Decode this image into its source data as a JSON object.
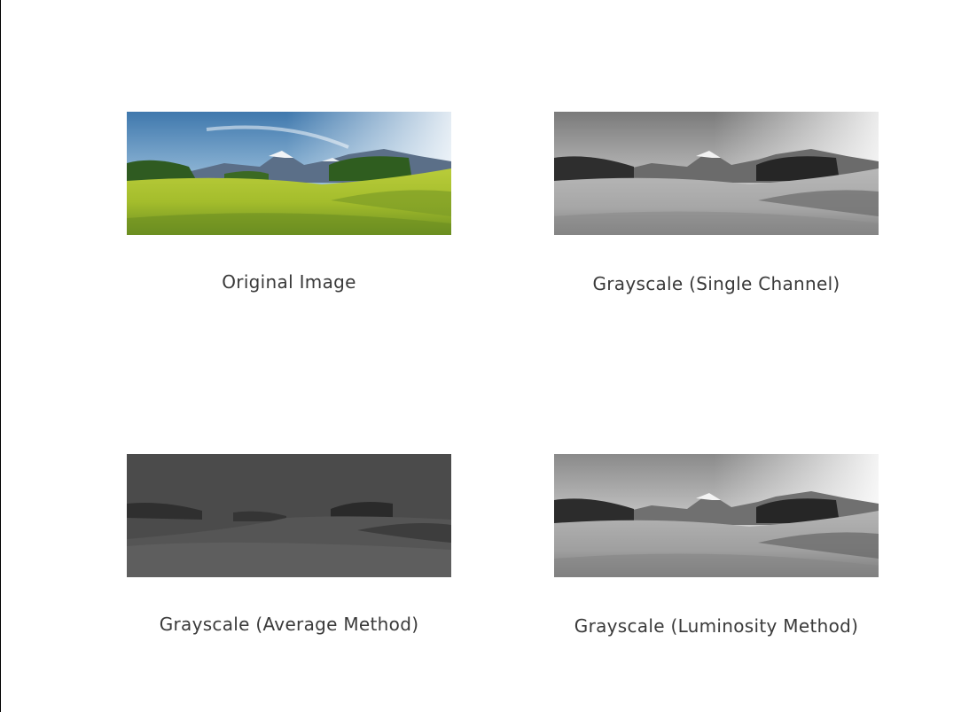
{
  "panels": [
    {
      "caption": "Original Image",
      "render": "color"
    },
    {
      "caption": "Grayscale (Single Channel)",
      "render": "gray"
    },
    {
      "caption": "Grayscale (Average Method)",
      "render": "dark"
    },
    {
      "caption": "Grayscale (Luminosity Method)",
      "render": "gray"
    }
  ],
  "colors": {
    "sky_top": "#4f86b8",
    "sky_bottom": "#e8eef2",
    "mountain": "#5a6e86",
    "snow": "#f3f5f7",
    "meadow_light": "#c9d53a",
    "meadow_dark": "#6f9a22",
    "trees": "#2f5d1f",
    "flat_gray": "#4a4a4a"
  }
}
